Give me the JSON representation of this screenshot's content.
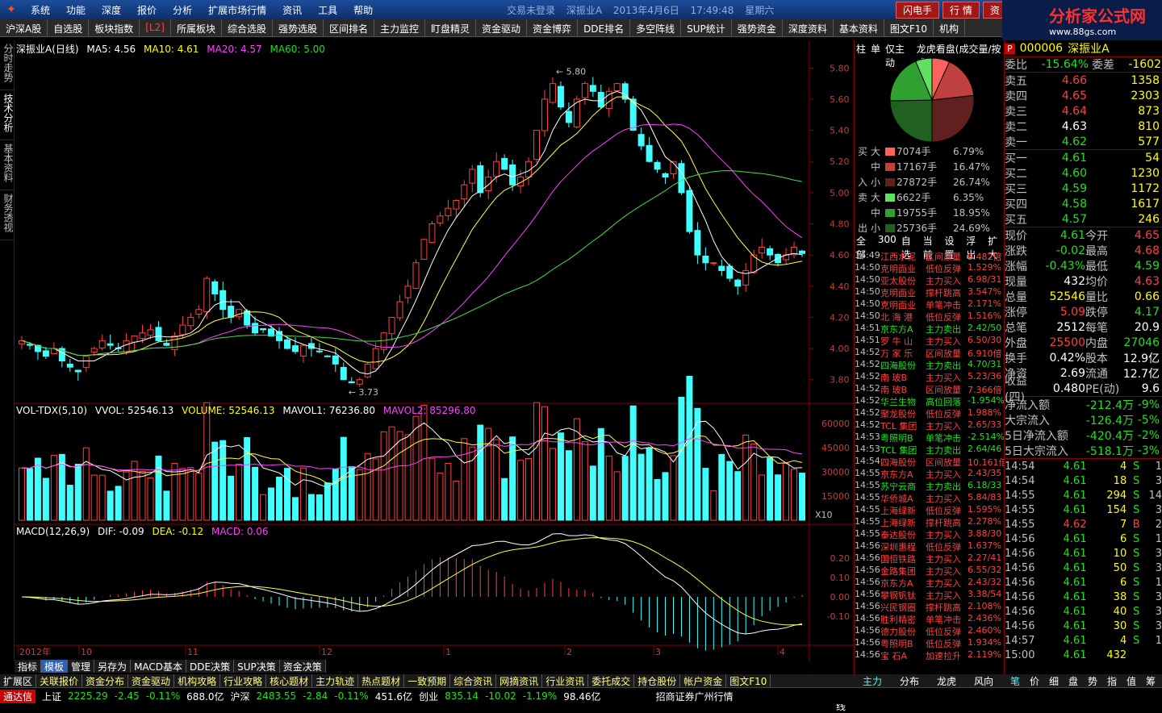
{
  "menubar": {
    "items": [
      "系统",
      "功能",
      "深度",
      "报价",
      "分析",
      "扩展市场行情",
      "资讯",
      "工具",
      "帮助"
    ],
    "status_trade": "交易未登录",
    "status_stock": "深振业A",
    "status_date": "2013年4月6日",
    "status_time": "17:49:48",
    "status_weekday": "星期六",
    "btn_flash": "闪电手",
    "btn_quote": "行 情",
    "btn_info": "资",
    "brand_name": "分析家公式网",
    "brand_url": "www.88gs.com"
  },
  "toolbar": {
    "items": [
      "沪深A股",
      "自选股",
      "板块指数",
      "[L2]",
      "所属板块",
      "综合选股",
      "强势选股",
      "区间排名",
      "主力监控",
      "盯盘精灵",
      "资金驱动",
      "资金博弈",
      "DDE排名",
      "多空阵线",
      "SUP统计",
      "强势资金",
      "深度资料",
      "基本资料",
      "图文F10",
      "机构"
    ]
  },
  "lefttabs": [
    "分时走势",
    "技术分析",
    "基本资料",
    "财务透视"
  ],
  "kline": {
    "title": "深振业A(日线)",
    "ma5": "MA5: 4.56",
    "ma10": "MA10: 4.61",
    "ma20": "MA20: 4.57",
    "ma60": "MA60: 5.00",
    "high_label": "5.80",
    "low_label": "3.73",
    "y_labels": [
      "5.80",
      "5.60",
      "5.40",
      "5.20",
      "5.00",
      "4.80",
      "4.60",
      "4.40",
      "4.20",
      "4.00",
      "3.80"
    ]
  },
  "volume": {
    "title": "VOL-TDX(5,10)",
    "vvol": "VVOL: 52546.13",
    "volume": "VOLUME: 52546.13",
    "mavol1": "MAVOL1: 76236.80",
    "mavol2": "MAVOL2: 85296.80",
    "y_labels": [
      "60000",
      "45000",
      "30000",
      "15000"
    ],
    "unit": "X10"
  },
  "macd": {
    "title": "MACD(12,26,9)",
    "dif": "DIF: -0.09",
    "dea": "DEA: -0.12",
    "macd": "MACD: 0.06",
    "y_labels": [
      "0.20",
      "0.10",
      "0.00",
      "-0.10"
    ]
  },
  "xaxis": {
    "labels": [
      "2012年",
      "10",
      "11",
      "12",
      "1",
      "2",
      "3",
      "4"
    ],
    "period": "日线",
    "controls": [
      "+",
      "-",
      "0"
    ]
  },
  "flow": {
    "tabs": [
      "柱",
      "单",
      "仅主动",
      "龙虎看盘(成交量/按成"
    ],
    "buy_label_top": "买",
    "buy_label_bot": "入",
    "sell_label_top": "卖",
    "sell_label_bot": "出",
    "rows": [
      {
        "side": "买",
        "lv": "大",
        "vol": "7074手",
        "pct": "6.79%",
        "color": "#ff6060"
      },
      {
        "side": "",
        "lv": "中",
        "vol": "17167手",
        "pct": "16.47%",
        "color": "#c04040"
      },
      {
        "side": "入",
        "lv": "小",
        "vol": "27872手",
        "pct": "26.74%",
        "color": "#602020"
      },
      {
        "side": "卖",
        "lv": "大",
        "vol": "6622手",
        "pct": "6.35%",
        "color": "#60e060"
      },
      {
        "side": "",
        "lv": "中",
        "vol": "19755手",
        "pct": "18.95%",
        "color": "#30a030"
      },
      {
        "side": "出",
        "lv": "小",
        "vol": "25736手",
        "pct": "24.69%",
        "color": "#206020"
      }
    ],
    "filter": [
      "全部",
      "300",
      "自选",
      "当前",
      "设置",
      "浮出",
      "扩大"
    ]
  },
  "news": [
    {
      "t": "14:49",
      "n": "江西水泥",
      "e": "区间放量",
      "v": "9.482倍"
    },
    {
      "t": "14:50",
      "n": "克明面业",
      "e": "低位反弹",
      "v": "1.529%"
    },
    {
      "t": "14:50",
      "n": "亚太股份",
      "e": "主力买入",
      "v": "6.98/31"
    },
    {
      "t": "14:50",
      "n": "克明面业",
      "e": "撑杆跳高",
      "v": "3.547%"
    },
    {
      "t": "14:50",
      "n": "克明面业",
      "e": "单笔冲击",
      "v": "2.171%"
    },
    {
      "t": "14:50",
      "n": "北 海 港",
      "e": "低位反弹",
      "v": "1.516%"
    },
    {
      "t": "14:51",
      "n": "京东方A",
      "e": "主力卖出",
      "v": "2.42/50"
    },
    {
      "t": "14:51",
      "n": "罗 牛 山",
      "e": "主力买入",
      "v": "6.50/30"
    },
    {
      "t": "14:52",
      "n": "万 家 乐",
      "e": "区间放量",
      "v": "6.910倍"
    },
    {
      "t": "14:52",
      "n": "四海股份",
      "e": "主力卖出",
      "v": "4.70/31"
    },
    {
      "t": "14:52",
      "n": "南 玻B",
      "e": "主力买入",
      "v": "5.23/36"
    },
    {
      "t": "14:52",
      "n": "南 玻B",
      "e": "区间放量",
      "v": "7.366倍"
    },
    {
      "t": "14:52",
      "n": "华兰生物",
      "e": "高位回落",
      "v": "-1.954%"
    },
    {
      "t": "14:52",
      "n": "聚龙股份",
      "e": "低位反弹",
      "v": "1.988%"
    },
    {
      "t": "14:52",
      "n": "TCL 集团",
      "e": "主力买入",
      "v": "2.65/33"
    },
    {
      "t": "14:53",
      "n": "粤照明B",
      "e": "单笔冲击",
      "v": "-2.514%"
    },
    {
      "t": "14:53",
      "n": "TCL 集团",
      "e": "主力卖出",
      "v": "2.64/46"
    },
    {
      "t": "14:54",
      "n": "四海股份",
      "e": "区间放量",
      "v": "10.161倍"
    },
    {
      "t": "14:55",
      "n": "京东方A",
      "e": "主力买入",
      "v": "2.43/35"
    },
    {
      "t": "14:55",
      "n": "苏宁云商",
      "e": "主力卖出",
      "v": "6.18/33"
    },
    {
      "t": "14:55",
      "n": "华侨城A",
      "e": "主力买入",
      "v": "5.84/83"
    },
    {
      "t": "14:55",
      "n": "上海绿新",
      "e": "低位反弹",
      "v": "1.595%"
    },
    {
      "t": "14:55",
      "n": "上海绿新",
      "e": "撑杆跳高",
      "v": "2.278%"
    },
    {
      "t": "14:55",
      "n": "泰达股份",
      "e": "主力买入",
      "v": "3.88/30"
    },
    {
      "t": "14:56",
      "n": "深圳惠程",
      "e": "低位反弹",
      "v": "1.637%"
    },
    {
      "t": "14:56",
      "n": "国恒铁路",
      "e": "主力买入",
      "v": "2.27/41"
    },
    {
      "t": "14:56",
      "n": "金路集团",
      "e": "主力买入",
      "v": "6.55/32"
    },
    {
      "t": "14:56",
      "n": "京东方A",
      "e": "主力买入",
      "v": "2.43/32"
    },
    {
      "t": "14:56",
      "n": "攀钢钒钛",
      "e": "主力买入",
      "v": "3.38/54"
    },
    {
      "t": "14:56",
      "n": "兴民钢圈",
      "e": "撑杆跳高",
      "v": "2.108%"
    },
    {
      "t": "14:56",
      "n": "胜利精密",
      "e": "单笔冲击",
      "v": "2.436%"
    },
    {
      "t": "14:56",
      "n": "德力股份",
      "e": "低位反弹",
      "v": "2.460%"
    },
    {
      "t": "14:56",
      "n": "粤照明B",
      "e": "低位反弹",
      "v": "1.934%"
    },
    {
      "t": "14:56",
      "n": "宝 石A",
      "e": "加速拉升",
      "v": "2.119%"
    }
  ],
  "quote": {
    "p_badge": "P",
    "code": "000006",
    "name": "深振业A",
    "weibi_label": "委比",
    "weibi": "-15.64%",
    "weicha_label": "委差",
    "weicha": "-1602",
    "asks": [
      {
        "l": "卖五",
        "p": "4.66",
        "v": "1358",
        "c": "red"
      },
      {
        "l": "卖四",
        "p": "4.65",
        "v": "2303",
        "c": "red"
      },
      {
        "l": "卖三",
        "p": "4.64",
        "v": "873",
        "c": "red"
      },
      {
        "l": "卖二",
        "p": "4.63",
        "v": "810",
        "c": "white"
      },
      {
        "l": "卖一",
        "p": "4.62",
        "v": "577",
        "c": "green"
      }
    ],
    "bids": [
      {
        "l": "买一",
        "p": "4.61",
        "v": "54",
        "c": "green"
      },
      {
        "l": "买二",
        "p": "4.60",
        "v": "1230",
        "c": "green"
      },
      {
        "l": "买三",
        "p": "4.59",
        "v": "1172",
        "c": "green"
      },
      {
        "l": "买四",
        "p": "4.58",
        "v": "1617",
        "c": "green"
      },
      {
        "l": "买五",
        "p": "4.57",
        "v": "246",
        "c": "green"
      }
    ],
    "stats": [
      {
        "l": "现价",
        "a": "4.61",
        "ac": "green",
        "l2": "今开",
        "b": "4.65",
        "bc": "red"
      },
      {
        "l": "涨跌",
        "a": "-0.02",
        "ac": "green",
        "l2": "最高",
        "b": "4.68",
        "bc": "red"
      },
      {
        "l": "涨幅",
        "a": "-0.43%",
        "ac": "green",
        "l2": "最低",
        "b": "4.59",
        "bc": "green"
      },
      {
        "l": "现量",
        "a": "432",
        "ac": "white",
        "l2": "均价",
        "b": "4.63",
        "bc": "red"
      },
      {
        "l": "总量",
        "a": "52546",
        "ac": "yellow",
        "l2": "量比",
        "b": "0.66",
        "bc": "yellow"
      },
      {
        "l": "涨停",
        "a": "5.09",
        "ac": "red",
        "l2": "跌停",
        "b": "4.17",
        "bc": "green"
      },
      {
        "l": "总笔",
        "a": "2512",
        "ac": "white",
        "l2": "每笔",
        "b": "20.9",
        "bc": "white"
      },
      {
        "l": "外盘",
        "a": "25500",
        "ac": "red",
        "l2": "内盘",
        "b": "27046",
        "bc": "green"
      },
      {
        "l": "换手",
        "a": "0.42%",
        "ac": "white",
        "l2": "股本",
        "b": "12.9亿",
        "bc": "white"
      },
      {
        "l": "净资",
        "a": "2.69",
        "ac": "white",
        "l2": "流通",
        "b": "12.7亿",
        "bc": "white"
      },
      {
        "l": "收益(四)",
        "a": "0.480",
        "ac": "white",
        "l2": "PE(动)",
        "b": "9.6",
        "bc": "white"
      }
    ],
    "flows": [
      {
        "l": "净流入额",
        "a": "-212.4万",
        "b": "-9%"
      },
      {
        "l": "大宗流入",
        "a": "-126.4万",
        "b": "-5%"
      },
      {
        "l": "5日净流入额",
        "a": "-420.4万",
        "b": "-2%"
      },
      {
        "l": "5日大宗流入",
        "a": "-518.1万",
        "b": "-3%"
      }
    ],
    "ticks": [
      {
        "tm": "14:54",
        "pr": "4.61",
        "vl": "4",
        "bs": "S",
        "nn": "1"
      },
      {
        "tm": "14:54",
        "pr": "4.61",
        "vl": "18",
        "bs": "S",
        "nn": "3"
      },
      {
        "tm": "14:55",
        "pr": "4.61",
        "vl": "294",
        "bs": "S",
        "nn": "14"
      },
      {
        "tm": "14:55",
        "pr": "4.61",
        "vl": "154",
        "bs": "S",
        "nn": "3"
      },
      {
        "tm": "14:55",
        "pr": "4.62",
        "vl": "7",
        "bs": "B",
        "nn": "2"
      },
      {
        "tm": "14:56",
        "pr": "4.61",
        "vl": "6",
        "bs": "S",
        "nn": "1"
      },
      {
        "tm": "14:56",
        "pr": "4.61",
        "vl": "10",
        "bs": "S",
        "nn": "3"
      },
      {
        "tm": "14:56",
        "pr": "4.61",
        "vl": "50",
        "bs": "S",
        "nn": "3"
      },
      {
        "tm": "14:56",
        "pr": "4.61",
        "vl": "6",
        "bs": "S",
        "nn": "1"
      },
      {
        "tm": "14:56",
        "pr": "4.61",
        "vl": "38",
        "bs": "S",
        "nn": "3"
      },
      {
        "tm": "14:56",
        "pr": "4.61",
        "vl": "40",
        "bs": "S",
        "nn": "3"
      },
      {
        "tm": "14:56",
        "pr": "4.61",
        "vl": "30",
        "bs": "S",
        "nn": "3"
      },
      {
        "tm": "14:57",
        "pr": "4.61",
        "vl": "4",
        "bs": "S",
        "nn": "1"
      },
      {
        "tm": "15:00",
        "pr": "4.61",
        "vl": "432",
        "bs": "",
        "nn": ""
      }
    ]
  },
  "bottabs1": [
    "指标",
    "模板",
    "管理",
    "另存为",
    "MACD基本",
    "DDE决策",
    "SUP决策",
    "资金决策"
  ],
  "bottabs2": [
    "扩展区",
    "关联报价",
    "资金分布",
    "资金驱动",
    "机构攻略",
    "行业攻略",
    "核心题材",
    "主力轨迹",
    "热点题材",
    "一致预期",
    "综合资讯",
    "网摘资讯",
    "行业资讯",
    "委托成交",
    "持仓股份",
    "帐户资金",
    "图文F10"
  ],
  "rtabs": [
    "主力",
    "分布",
    "龙虎",
    "风向"
  ],
  "rtabs2": [
    "笔",
    "价",
    "细",
    "盘",
    "势",
    "指",
    "值",
    "筹"
  ],
  "statusbar": {
    "brand": "通达信",
    "sh_label": "上证",
    "sh": "2225.29",
    "sh_chg": "-2.45",
    "sh_pct": "-0.11%",
    "sh_amt": "688.0亿",
    "sz_label": "沪深",
    "sz": "2483.55",
    "sz_chg": "-2.84",
    "sz_pct": "-0.11%",
    "sz_amt": "451.6亿",
    "cy_label": "创业",
    "cy": "835.14",
    "cy_chg": "-10.02",
    "cy_pct": "-1.19%",
    "cy_amt": "98.46亿",
    "broker": "招商证券广州行情"
  },
  "chart_data": {
    "type": "candlestick",
    "title": "深振业A(日线)",
    "ylim": [
      3.7,
      5.9
    ],
    "x_month_labels": [
      "2012年",
      "10",
      "11",
      "12",
      "1",
      "2",
      "3",
      "4"
    ],
    "ohlc_close": [
      4.05,
      4.02,
      3.98,
      3.95,
      4.0,
      3.92,
      3.88,
      3.85,
      3.95,
      4.0,
      4.05,
      4.02,
      4.0,
      4.05,
      4.08,
      4.1,
      4.12,
      4.05,
      4.02,
      4.08,
      4.15,
      4.2,
      4.25,
      4.45,
      4.35,
      4.25,
      4.2,
      4.25,
      4.15,
      4.1,
      4.12,
      4.08,
      4.05,
      4.0,
      3.98,
      4.02,
      4.0,
      3.98,
      3.95,
      3.9,
      3.8,
      3.78,
      3.8,
      3.9,
      4.0,
      4.1,
      4.2,
      4.3,
      4.4,
      4.55,
      4.7,
      4.8,
      4.85,
      4.9,
      4.95,
      5.05,
      5.15,
      5.0,
      5.1,
      5.2,
      5.15,
      5.05,
      5.1,
      5.2,
      5.4,
      5.6,
      5.7,
      5.55,
      5.45,
      5.6,
      5.7,
      5.65,
      5.55,
      5.65,
      5.7,
      5.6,
      5.4,
      5.3,
      5.2,
      5.15,
      5.1,
      5.2,
      5.0,
      4.75,
      4.6,
      4.55,
      4.55,
      4.5,
      4.45,
      4.4,
      4.5,
      4.6,
      4.65,
      4.6,
      4.55,
      4.6,
      4.65,
      4.61
    ],
    "ma_legend": [
      "MA5: 4.56",
      "MA10: 4.61",
      "MA20: 4.57",
      "MA60: 5.00"
    ]
  }
}
